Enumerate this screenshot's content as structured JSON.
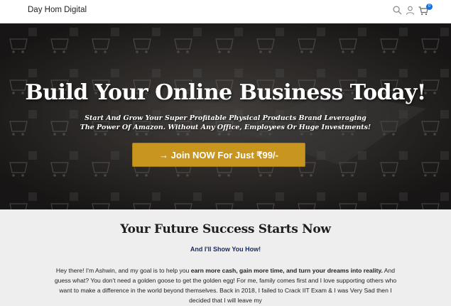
{
  "header": {
    "brand": "Day Hom Digital",
    "cart_count": "0",
    "icons": [
      "search-icon",
      "user-icon",
      "cart-icon"
    ]
  },
  "hero": {
    "title": "Build Your Online Business Today!",
    "subtitle": "Start And Grow Your Super Profitable Physical Products Brand Leveraging The Power Of Amazon. Without Any Office, Employees Or Huge Investments!",
    "cta_label": "→ Join NOW For Just ₹99/-"
  },
  "section": {
    "title": "Your Future Success Starts Now",
    "subtitle": "And I'll Show You How!",
    "para_1": "Hey there! I'm Ashwin, and my goal is to help you ",
    "para_bold": "earn more cash, gain more time, and turn your dreams into reality.",
    "para_2": " And guess what? You don't need a golden goose to get the golden egg! For me, family comes first and I love supporting others who want to make a difference in the world beyond themselves. Back in 2018, I failed to Crack IIT Exam & I was Very Sad then I decided that I will leave my"
  },
  "colors": {
    "cta": "#c8961e",
    "accent": "#1a6fd6",
    "hero_overlay": "#2c2a29",
    "section_bg": "#eeeeee"
  }
}
